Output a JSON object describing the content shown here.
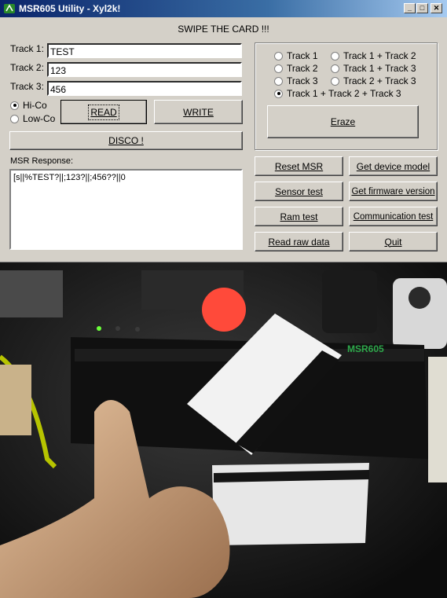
{
  "window": {
    "title": "MSR605 Utility - Xyl2k!"
  },
  "header": {
    "message": "SWIPE THE CARD !!!"
  },
  "tracks": [
    {
      "label": "Track 1:",
      "value": "TEST"
    },
    {
      "label": "Track 2:",
      "value": "123"
    },
    {
      "label": "Track 3:",
      "value": "456"
    }
  ],
  "coercivity": [
    {
      "label": "Hi-Co",
      "selected": true
    },
    {
      "label": "Low-Co",
      "selected": false
    }
  ],
  "buttons": {
    "read": "READ",
    "write": "WRITE",
    "disco": "DISCO !",
    "eraze": "Eraze",
    "reset_msr": "Reset MSR",
    "get_device_model": "Get device model",
    "sensor_test": "Sensor test",
    "get_firmware_version": "Get firmware version",
    "ram_test": "Ram test",
    "communication_test": "Communication test",
    "read_raw_data": "Read raw data",
    "quit": "Quit"
  },
  "erase_options": [
    {
      "label": "Track 1",
      "selected": false
    },
    {
      "label": "Track 1 + Track 2",
      "selected": false
    },
    {
      "label": "Track 2",
      "selected": false
    },
    {
      "label": "Track 1 + Track 3",
      "selected": false
    },
    {
      "label": "Track 3",
      "selected": false
    },
    {
      "label": "Track 2 + Track 3",
      "selected": false
    },
    {
      "label": "Track 1 + Track 2 + Track 3",
      "selected": true
    }
  ],
  "response": {
    "label": "MSR Response:",
    "text": "[s||%TEST?||;123?||;456??||0"
  },
  "photo": {
    "device_label": "MSR605"
  }
}
